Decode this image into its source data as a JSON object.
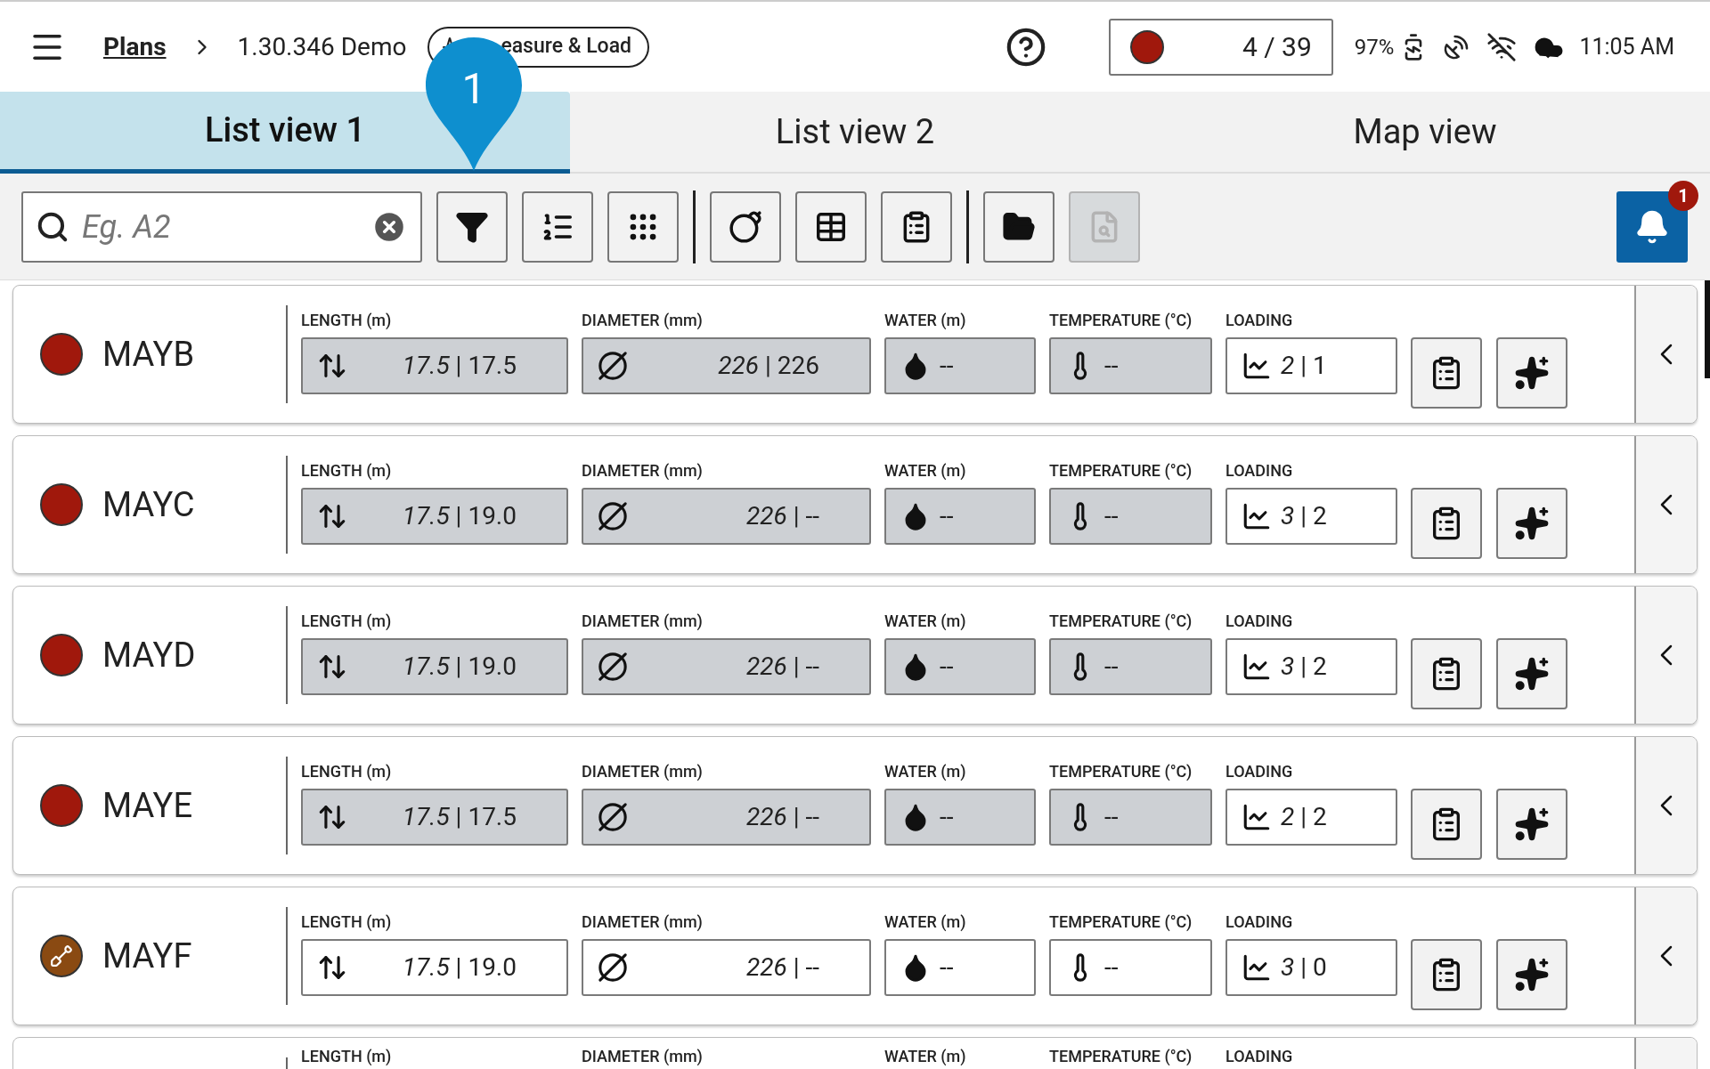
{
  "header": {
    "breadcrumb_link": "Plans",
    "breadcrumb_current": "1.30.346 Demo",
    "mode_badge": "easure & Load",
    "callout": "1",
    "counter": {
      "text": "4 / 39",
      "color": "#a0180c"
    },
    "battery": "97%",
    "time": "11:05 AM"
  },
  "tabs": [
    {
      "label": "List view 1",
      "selected": true
    },
    {
      "label": "List view 2",
      "selected": false
    },
    {
      "label": "Map view",
      "selected": false
    }
  ],
  "search": {
    "placeholder": "Eg. A2"
  },
  "toolbar_groups": [
    [
      {
        "kind": "filter",
        "disabled": false
      },
      {
        "kind": "sort",
        "disabled": false
      },
      {
        "kind": "dots",
        "disabled": false
      }
    ],
    [
      {
        "kind": "blast",
        "disabled": false
      },
      {
        "kind": "table",
        "disabled": false
      },
      {
        "kind": "clipboard",
        "disabled": false
      }
    ],
    [
      {
        "kind": "folder",
        "disabled": false
      },
      {
        "kind": "preview",
        "disabled": true
      }
    ]
  ],
  "notifications": "1",
  "rows": [
    {
      "name": "MAYB",
      "status": {
        "kind": "dot",
        "color": "#a0180c"
      },
      "fields": [
        {
          "kind": "length",
          "label": "LENGTH (m)",
          "value": "*17.5* | 17.5",
          "filled": true
        },
        {
          "kind": "diameter",
          "label": "DIAMETER (mm)",
          "value": "*226* | 226",
          "filled": true
        },
        {
          "kind": "water",
          "label": "WATER (m)",
          "value": "--",
          "filled": true
        },
        {
          "kind": "temperature",
          "label": "TEMPERATURE (°C)",
          "value": "--",
          "filled": true
        },
        {
          "kind": "loading",
          "label": "LOADING",
          "value": "*2* | 1",
          "filled": false
        }
      ]
    },
    {
      "name": "MAYC",
      "status": {
        "kind": "dot",
        "color": "#a0180c"
      },
      "fields": [
        {
          "kind": "length",
          "label": "LENGTH (m)",
          "value": "*17.5* | 19.0",
          "filled": true
        },
        {
          "kind": "diameter",
          "label": "DIAMETER (mm)",
          "value": "*226* | --",
          "filled": true
        },
        {
          "kind": "water",
          "label": "WATER (m)",
          "value": "--",
          "filled": true
        },
        {
          "kind": "temperature",
          "label": "TEMPERATURE (°C)",
          "value": "--",
          "filled": true
        },
        {
          "kind": "loading",
          "label": "LOADING",
          "value": "*3* | 2",
          "filled": false
        }
      ]
    },
    {
      "name": "MAYD",
      "status": {
        "kind": "dot",
        "color": "#a0180c"
      },
      "fields": [
        {
          "kind": "length",
          "label": "LENGTH (m)",
          "value": "*17.5* | 19.0",
          "filled": true
        },
        {
          "kind": "diameter",
          "label": "DIAMETER (mm)",
          "value": "*226* | --",
          "filled": true
        },
        {
          "kind": "water",
          "label": "WATER (m)",
          "value": "--",
          "filled": true
        },
        {
          "kind": "temperature",
          "label": "TEMPERATURE (°C)",
          "value": "--",
          "filled": true
        },
        {
          "kind": "loading",
          "label": "LOADING",
          "value": "*3* | 2",
          "filled": false
        }
      ]
    },
    {
      "name": "MAYE",
      "status": {
        "kind": "dot",
        "color": "#a0180c"
      },
      "fields": [
        {
          "kind": "length",
          "label": "LENGTH (m)",
          "value": "*17.5* | 17.5",
          "filled": true
        },
        {
          "kind": "diameter",
          "label": "DIAMETER (mm)",
          "value": "*226* | --",
          "filled": true
        },
        {
          "kind": "water",
          "label": "WATER (m)",
          "value": "--",
          "filled": true
        },
        {
          "kind": "temperature",
          "label": "TEMPERATURE (°C)",
          "value": "--",
          "filled": true
        },
        {
          "kind": "loading",
          "label": "LOADING",
          "value": "*2* | 2",
          "filled": false
        }
      ]
    },
    {
      "name": "MAYF",
      "status": {
        "kind": "dig",
        "color": "#8a4a12"
      },
      "fields": [
        {
          "kind": "length",
          "label": "LENGTH (m)",
          "value": "*17.5* | 19.0",
          "filled": false
        },
        {
          "kind": "diameter",
          "label": "DIAMETER (mm)",
          "value": "*226* | --",
          "filled": false
        },
        {
          "kind": "water",
          "label": "WATER (m)",
          "value": "--",
          "filled": false
        },
        {
          "kind": "temperature",
          "label": "TEMPERATURE (°C)",
          "value": "--",
          "filled": false
        },
        {
          "kind": "loading",
          "label": "LOADING",
          "value": "*3* | 0",
          "filled": false
        }
      ]
    }
  ],
  "next_row_labels": [
    "LENGTH (m)",
    "DIAMETER (mm)",
    "WATER (m)",
    "TEMPERATURE (°C)",
    "LOADING"
  ]
}
